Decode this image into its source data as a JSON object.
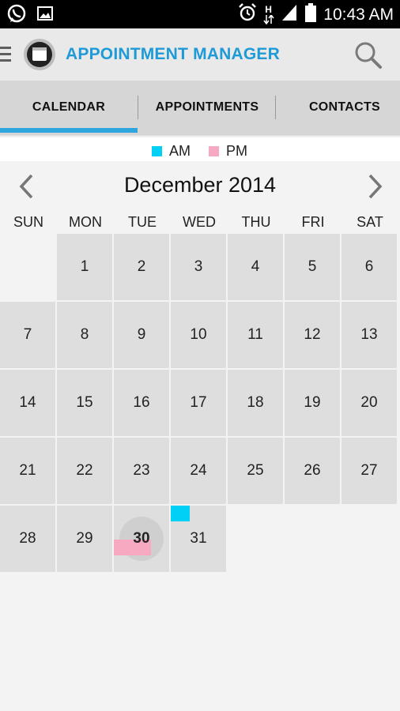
{
  "status_bar": {
    "time": "10:43 AM",
    "network_label": "H",
    "left_icons": [
      "whatsapp-icon",
      "image-icon"
    ],
    "right_icons": [
      "alarm-icon",
      "network-h-icon",
      "signal-icon",
      "battery-icon"
    ]
  },
  "app_bar": {
    "title": "APPOINTMENT MANAGER",
    "logo_icon": "calendar-logo-icon",
    "search_icon": "search-icon"
  },
  "tabs": [
    {
      "label": "CALENDAR",
      "active": true
    },
    {
      "label": "APPOINTMENTS",
      "active": false
    },
    {
      "label": "CONTACTS",
      "active": false
    }
  ],
  "legend": {
    "am": {
      "label": "AM",
      "color": "#00cff6"
    },
    "pm": {
      "label": "PM",
      "color": "#f7a9c2"
    }
  },
  "calendar": {
    "month_title": "December 2014",
    "prev_icon": "chevron-left-icon",
    "next_icon": "chevron-right-icon",
    "weekdays": [
      "SUN",
      "MON",
      "TUE",
      "WED",
      "THU",
      "FRI",
      "SAT"
    ],
    "days": [
      "1",
      "2",
      "3",
      "4",
      "5",
      "6",
      "7",
      "8",
      "9",
      "10",
      "11",
      "12",
      "13",
      "14",
      "15",
      "16",
      "17",
      "18",
      "19",
      "20",
      "21",
      "22",
      "23",
      "24",
      "25",
      "26",
      "27",
      "28",
      "29",
      "30",
      "31"
    ],
    "today": "30",
    "pm_appointments": [
      "30"
    ],
    "am_appointments": [
      "31"
    ]
  },
  "colors": {
    "accent": "#1e9ad6",
    "tab_indicator": "#2ea6dd",
    "cell": "#dedede",
    "background": "#f3f3f3"
  }
}
